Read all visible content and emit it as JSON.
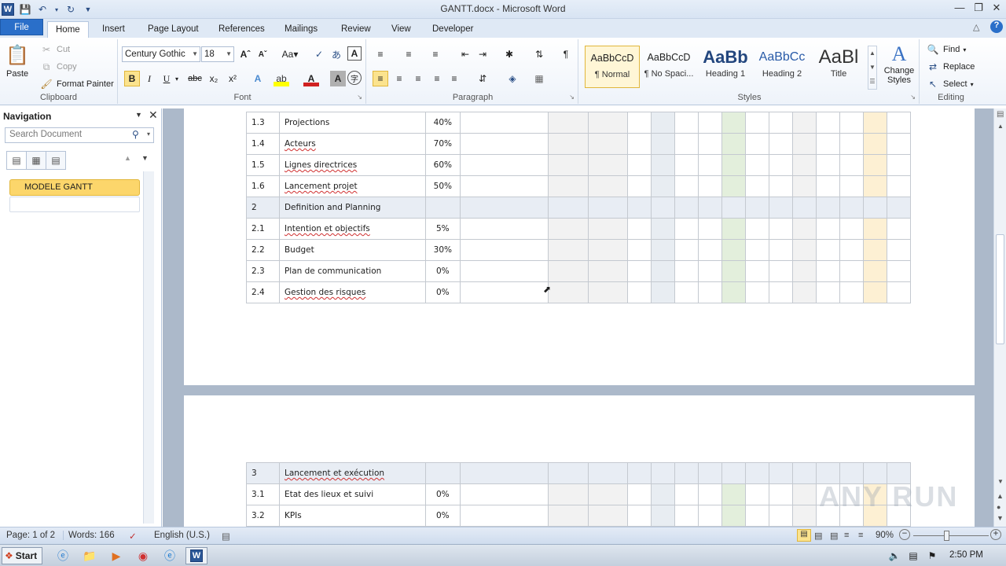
{
  "window": {
    "title": "GANTT.docx - Microsoft Word"
  },
  "quick_access": {
    "save": "save-icon",
    "undo": "undo-icon",
    "redo": "redo-icon"
  },
  "tabs": [
    "File",
    "Home",
    "Insert",
    "Page Layout",
    "References",
    "Mailings",
    "Review",
    "View",
    "Developer"
  ],
  "ribbon": {
    "clipboard": {
      "label": "Clipboard",
      "paste": "Paste",
      "cut": "Cut",
      "copy": "Copy",
      "format_painter": "Format Painter"
    },
    "font": {
      "label": "Font",
      "family": "Century Gothic",
      "size": "18"
    },
    "paragraph": {
      "label": "Paragraph"
    },
    "styles": {
      "label": "Styles",
      "items": [
        {
          "preview": "AaBbCcD",
          "name": "¶ Normal"
        },
        {
          "preview": "AaBbCcD",
          "name": "¶ No Spaci..."
        },
        {
          "preview": "AaBb",
          "name": "Heading 1"
        },
        {
          "preview": "AaBbCc",
          "name": "Heading 2"
        },
        {
          "preview": "AaBl",
          "name": "Title"
        }
      ],
      "change_styles": "Change Styles"
    },
    "editing": {
      "label": "Editing",
      "find": "Find",
      "replace": "Replace",
      "select": "Select"
    }
  },
  "navigation": {
    "title": "Navigation",
    "search_placeholder": "Search Document",
    "heading_item": "MODELE GANTT"
  },
  "document": {
    "page1_rows": [
      {
        "num": "1.3",
        "task": "Projections",
        "pct": "40%"
      },
      {
        "num": "1.4",
        "task": "Acteurs",
        "pct": "70%"
      },
      {
        "num": "1.5",
        "task": "Lignes directrices",
        "pct": "60%"
      },
      {
        "num": "1.6",
        "task": "Lancement projet",
        "pct": "50%"
      },
      {
        "num": "2",
        "task": "Definition and Planning",
        "pct": ""
      },
      {
        "num": "2.1",
        "task": "Intention et objectifs",
        "pct": "5%"
      },
      {
        "num": "2.2",
        "task": "Budget",
        "pct": "30%"
      },
      {
        "num": "2.3",
        "task": "Plan de communication",
        "pct": "0%"
      },
      {
        "num": "2.4",
        "task": "Gestion des risques",
        "pct": "0%"
      }
    ],
    "page2_rows": [
      {
        "num": "3",
        "task": "Lancement et exécution",
        "pct": ""
      },
      {
        "num": "3.1",
        "task": "Etat des lieux et suivi",
        "pct": "0%"
      },
      {
        "num": "3.2",
        "task": "KPIs",
        "pct": "0%"
      }
    ],
    "watermark": "ANY RUN"
  },
  "status": {
    "page": "Page: 1 of 2",
    "words": "Words: 166",
    "language": "English (U.S.)",
    "zoom": "90%"
  },
  "taskbar": {
    "start": "Start",
    "time": "2:50 PM"
  }
}
